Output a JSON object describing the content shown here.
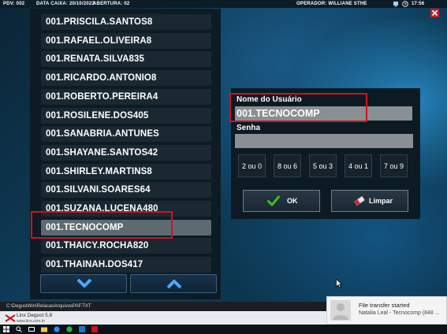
{
  "topbar": {
    "pdv": "PDV: 002",
    "date": "DATA CAIXA: 20/10/2022",
    "abertura": "ABERTURA: 02",
    "operador": "OPERADOR: WILLIANE STHE",
    "clock": "17:56"
  },
  "users": [
    "001.PRISCILA.SANTOS8",
    "001.RAFAEL.OLIVEIRA8",
    "001.RENATA.SILVA835",
    "001.RICARDO.ANTONIO8",
    "001.ROBERTO.PEREIRA4",
    "001.ROSILENE.DOS405",
    "001.SANABRIA.ANTUNES",
    "001.SHAYANE.SANTOS42",
    "001.SHIRLEY.MARTINS8",
    "001.SILVANI.SOARES64",
    "001.SUZANA.LUCENA480",
    "001.TECNOCOMP",
    "001.THAICY.ROCHA820",
    "001.THAINAH.DOS417"
  ],
  "selected_user_index": 11,
  "login": {
    "username_label": "Nome do Usuário",
    "username_value": "001.TECNOCOMP",
    "password_label": "Senha",
    "password_value": "",
    "patterns": [
      "2 ou 0",
      "8 ou 6",
      "5 ou 3",
      "4 ou 1",
      "7 ou 9"
    ],
    "ok_label": "OK",
    "clear_label": "Limpar"
  },
  "status": {
    "path": "C:\\DegustWin\\RelacaoArquivosPAF.TXT"
  },
  "brand": {
    "name": "Linx Degust 5.8",
    "site": "www.linx.com.br"
  },
  "notification": {
    "title": "File transfer started",
    "text": "Natalia Leal - Tecnocomp (848 ..."
  },
  "colors": {
    "accent_red": "#d0121b",
    "ok_green": "#3fbf2a",
    "selected_row": "#5e6a71"
  }
}
